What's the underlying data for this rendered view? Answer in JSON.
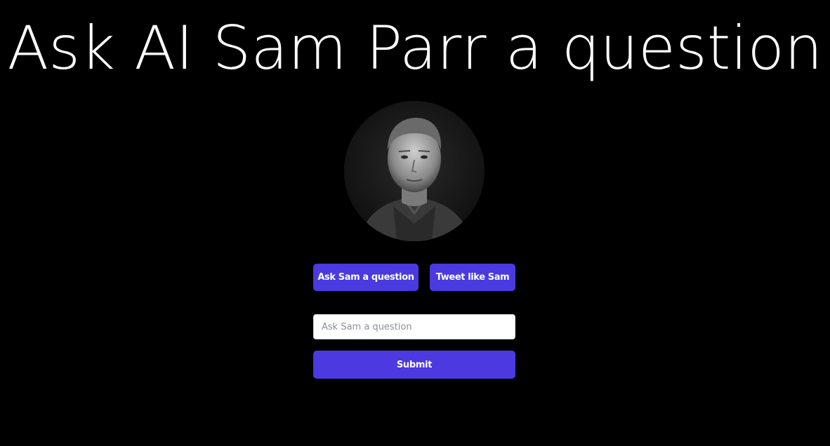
{
  "header": {
    "title": "Ask AI Sam Parr a question"
  },
  "avatar": {
    "icon": "person-photo",
    "style": "grayscale"
  },
  "modes": {
    "ask_label": "Ask Sam a question",
    "tweet_label": "Tweet like Sam"
  },
  "form": {
    "input_placeholder": "Ask Sam a question",
    "input_value": "",
    "submit_label": "Submit"
  },
  "colors": {
    "background": "#000000",
    "accent": "#4a3adf",
    "text": "#ffffff"
  }
}
